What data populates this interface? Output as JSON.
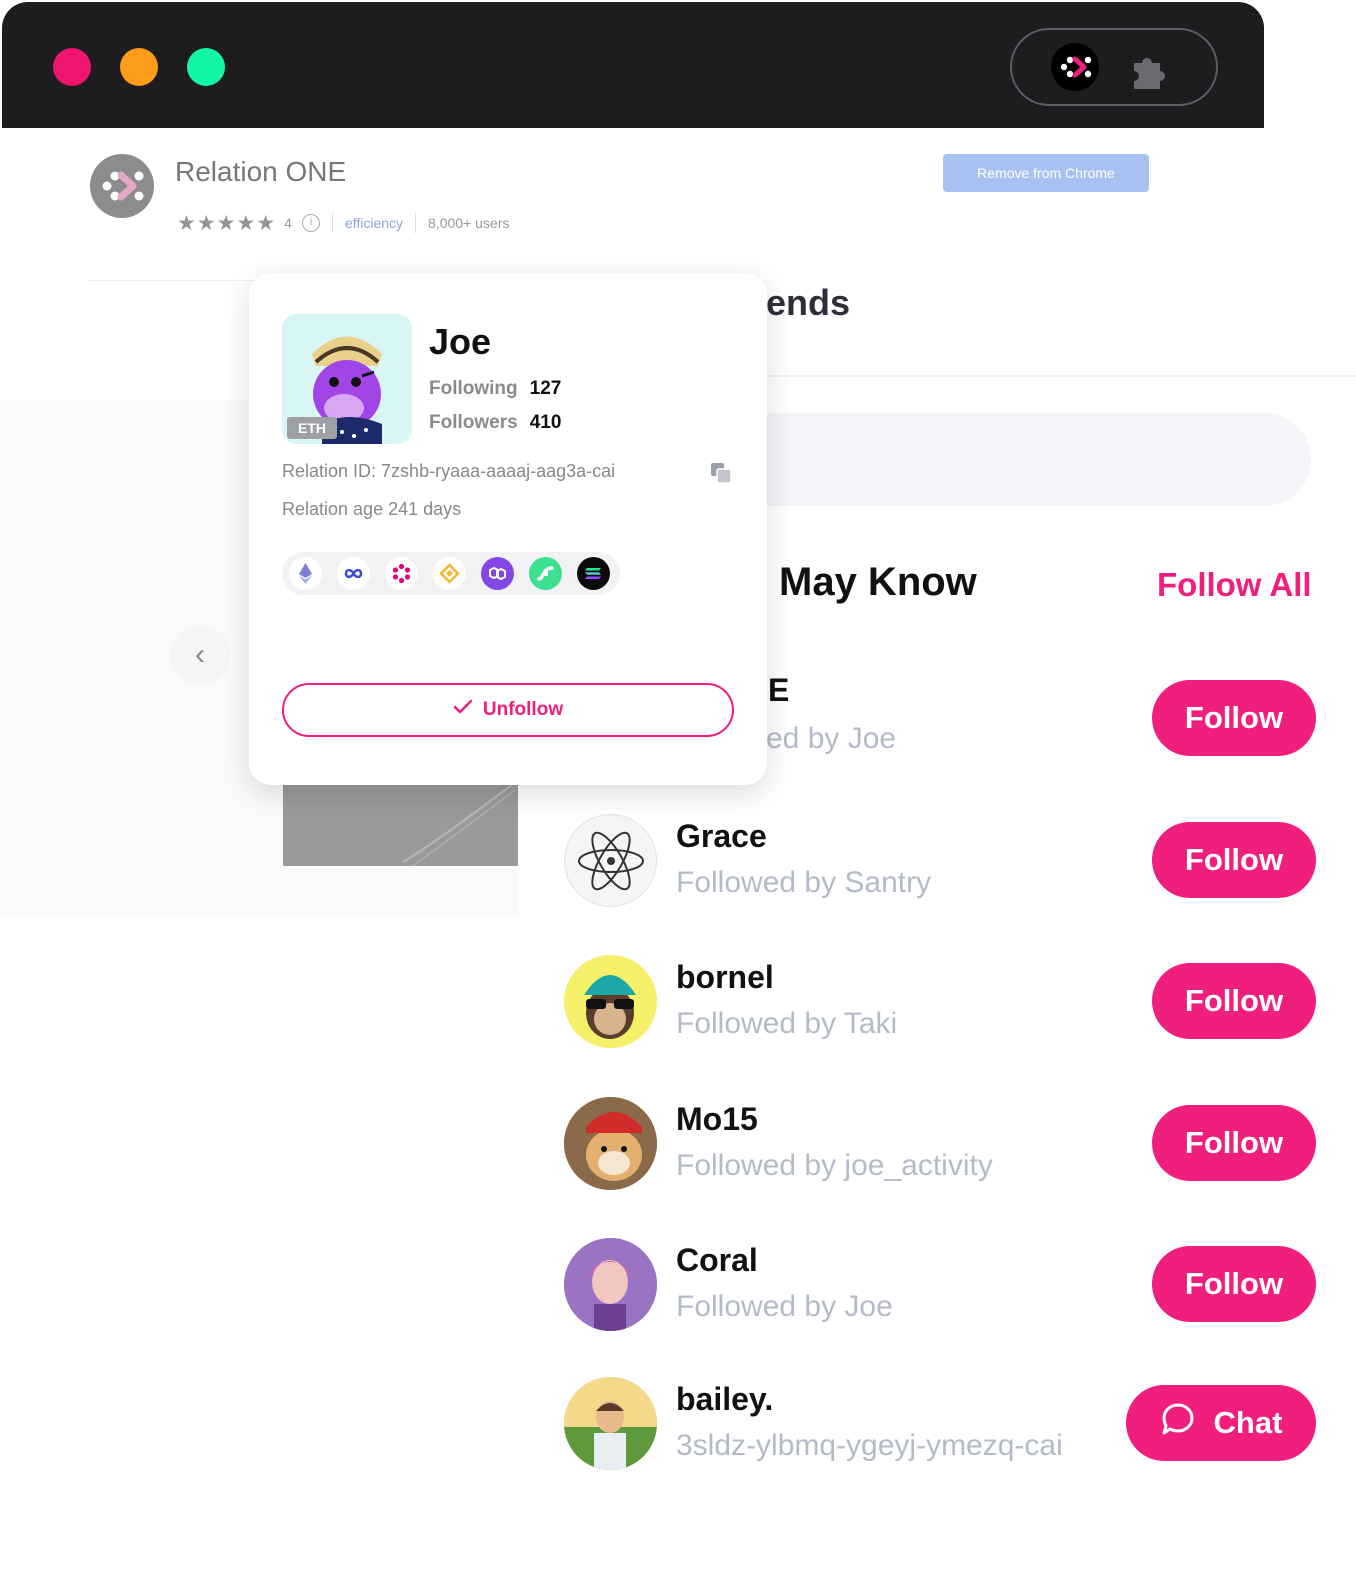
{
  "browser": {
    "extensions": [
      "relation-one-icon",
      "puzzle-icon"
    ]
  },
  "store": {
    "title": "Relation ONE",
    "rating_stars": "★★★★★",
    "rating_count": "4",
    "info_symbol": "i",
    "category": "efficiency",
    "users": "8,000+ users",
    "remove_label": "Remove from Chrome"
  },
  "page": {
    "friends_heading_fragment": "ends",
    "section_title_fragment": "May Know",
    "follow_all": "Follow All",
    "prev_arrow": "‹",
    "partial_row": {
      "name_fragment": "E",
      "sub_fragment": "ed by Joe"
    },
    "people": [
      {
        "name": "Grace",
        "sub": "Followed by Santry",
        "action": "Follow"
      },
      {
        "name": "bornel",
        "sub": "Followed by Taki",
        "action": "Follow"
      },
      {
        "name": "Mo15",
        "sub": "Followed by joe_activity",
        "action": "Follow"
      },
      {
        "name": "Coral",
        "sub": "Followed by Joe",
        "action": "Follow"
      },
      {
        "name": "bailey.",
        "sub": "3sldz-ylbmq-ygeyj-ymezq-cai",
        "action": "Chat"
      }
    ]
  },
  "popup": {
    "name": "Joe",
    "badge": "ETH",
    "following_label": "Following",
    "following_count": "127",
    "followers_label": "Followers",
    "followers_count": "410",
    "relation_id": "Relation ID: 7zshb-ryaaa-aaaaj-aag3a-cai",
    "relation_age": "Relation age 241 days",
    "chains": [
      "ethereum-icon",
      "internet-computer-icon",
      "polkadot-icon",
      "bnb-icon",
      "polygon-icon",
      "flow-icon",
      "solana-icon"
    ],
    "unfollow_label": "Unfollow"
  },
  "colors": {
    "accent": "#f01e7d",
    "muted_text": "#b4bbc8",
    "chrome_bg": "#1e1c1f"
  }
}
